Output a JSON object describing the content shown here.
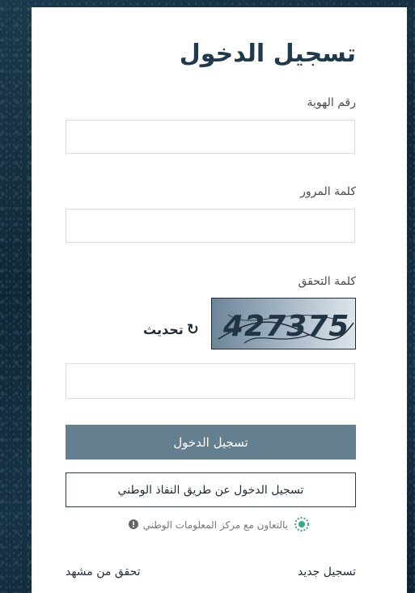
{
  "form": {
    "title": "تسجيل الدخول",
    "id_label": "رقم الهوية",
    "id_value": "",
    "password_label": "كلمة المرور",
    "password_value": "",
    "captcha_label": "كلمة التحقق",
    "captcha_text": "427375",
    "refresh_label": "تحديث",
    "captcha_input_value": "",
    "login_button": "تسجيل الدخول",
    "nafath_button": "تسجيل الدخول عن طريق النفاذ الوطني",
    "partner_text": "بالتعاون مع مركز المعلومات الوطني",
    "register_link": "تسجيل جديد",
    "verify_link": "تحقق من مشهد"
  },
  "colors": {
    "primary_button": "#647f8f",
    "title": "#1f3a4b"
  },
  "icons": {
    "refresh": "refresh-icon",
    "info": "info-icon",
    "nic_logo": "nic-logo-icon"
  }
}
